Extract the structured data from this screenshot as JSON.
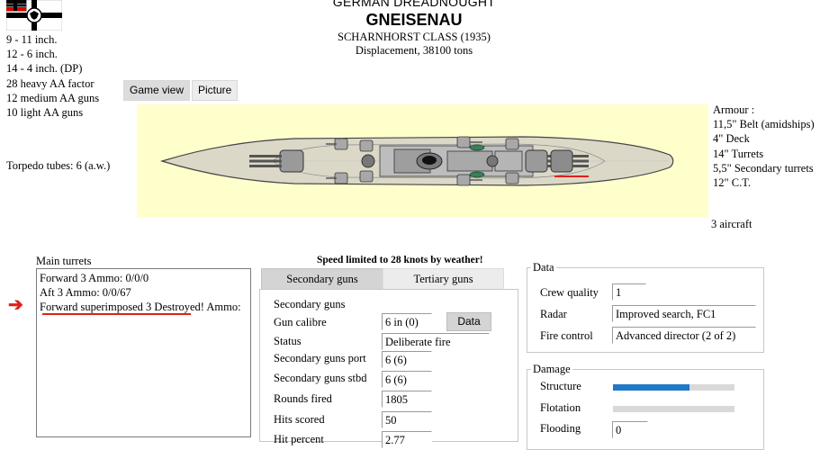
{
  "header": {
    "nation_type": "GERMAN DREADNOUGHT",
    "ship_name": "GNEISENAU",
    "class_line": "SCHARNHORST CLASS (1935)",
    "displacement_line": "Displacement, 38100 tons"
  },
  "armament": [
    "9 - 11 inch.",
    "12 - 6 inch.",
    "14 - 4 inch. (DP)",
    "28 heavy AA factor",
    "12 medium AA guns",
    "10 light AA guns"
  ],
  "torpedo": "Torpedo tubes: 6 (a.w.)",
  "view_tabs": {
    "game_view": "Game view",
    "picture": "Picture"
  },
  "armour": {
    "title": "Armour :",
    "items": [
      "11,5\" Belt (amidships)",
      "4\" Deck",
      "14\" Turrets",
      "5,5\" Secondary turrets",
      "12\" C.T."
    ]
  },
  "aircraft": "3 aircraft",
  "main_turrets": {
    "label": "Main turrets",
    "items": [
      "Forward 3 Ammo: 0/0/0",
      "Aft 3 Ammo: 0/0/67",
      "Forward superimposed 3 Destroyed! Ammo:"
    ]
  },
  "speed_notice": "Speed limited to 28 knots by weather!",
  "gun_tabs": {
    "secondary": "Secondary guns",
    "tertiary": "Tertiary guns"
  },
  "secondary": {
    "title": "Secondary guns",
    "data_button": "Data",
    "rows": [
      {
        "label": "Gun calibre",
        "value": "6 in (0)"
      },
      {
        "label": "Status",
        "value": "Deliberate fire"
      },
      {
        "label": "Secondary guns port",
        "value": "6 (6)"
      },
      {
        "label": "Secondary guns stbd",
        "value": "6 (6)"
      },
      {
        "label": "Rounds fired",
        "value": "1805"
      },
      {
        "label": "Hits scored",
        "value": "50"
      },
      {
        "label": "Hit percent",
        "value": "2.77"
      }
    ]
  },
  "data_group": {
    "title": "Data",
    "rows": [
      {
        "label": "Crew quality",
        "value": "1"
      },
      {
        "label": "Radar",
        "value": "Improved search, FC1"
      },
      {
        "label": "Fire control",
        "value": "Advanced director (2 of 2)"
      }
    ]
  },
  "damage_group": {
    "title": "Damage",
    "structure_label": "Structure",
    "structure_level": 0.63,
    "flotation_label": "Flotation",
    "flotation_level": 0,
    "flooding_label": "Flooding",
    "flooding_value": "0"
  },
  "colors": {
    "ship_panel_bg": "#ffffcc",
    "hull": "#dcd8c8",
    "deck": "#bdbdbd",
    "alert_red": "#e0201c",
    "bar_fill": "#1f78c8",
    "bar_track": "#d9d9d9"
  }
}
